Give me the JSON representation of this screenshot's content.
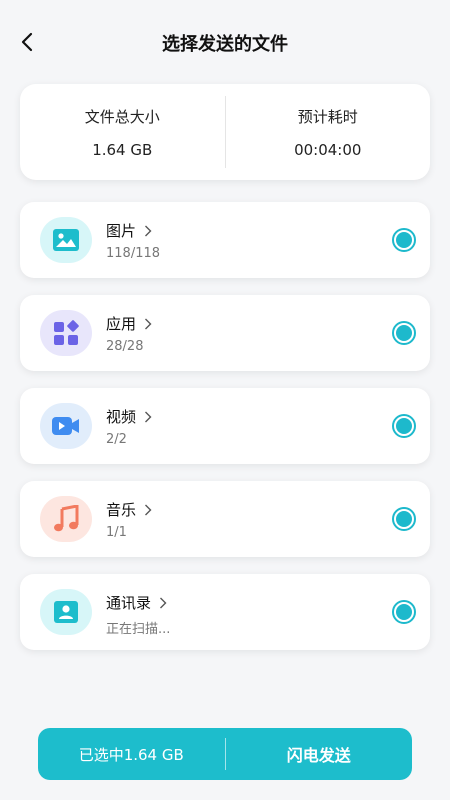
{
  "header": {
    "title": "选择发送的文件",
    "back_icon": "chevron-left-icon"
  },
  "summary": {
    "size_label": "文件总大小",
    "size_value": "1.64 GB",
    "time_label": "预计耗时",
    "time_value": "00:04:00"
  },
  "items": [
    {
      "name": "图片",
      "count": "118/118",
      "icon": "image-icon",
      "color": "#1dbdcc",
      "bg": "#d7f6f8"
    },
    {
      "name": "应用",
      "count": "28/28",
      "icon": "apps-icon",
      "color": "#6b63e6",
      "bg": "#e8e6fb"
    },
    {
      "name": "视频",
      "count": "2/2",
      "icon": "video-icon",
      "color": "#3f8cf0",
      "bg": "#e1edfb"
    },
    {
      "name": "音乐",
      "count": "1/1",
      "icon": "music-icon",
      "color": "#f27a5e",
      "bg": "#fde6e0"
    },
    {
      "name": "通讯录",
      "count": "正在扫描...",
      "icon": "contact-icon",
      "color": "#1dbdcc",
      "bg": "#d7f6f8"
    }
  ],
  "bottom": {
    "selected_text": "已选中1.64 GB",
    "send_label": "闪电发送"
  }
}
